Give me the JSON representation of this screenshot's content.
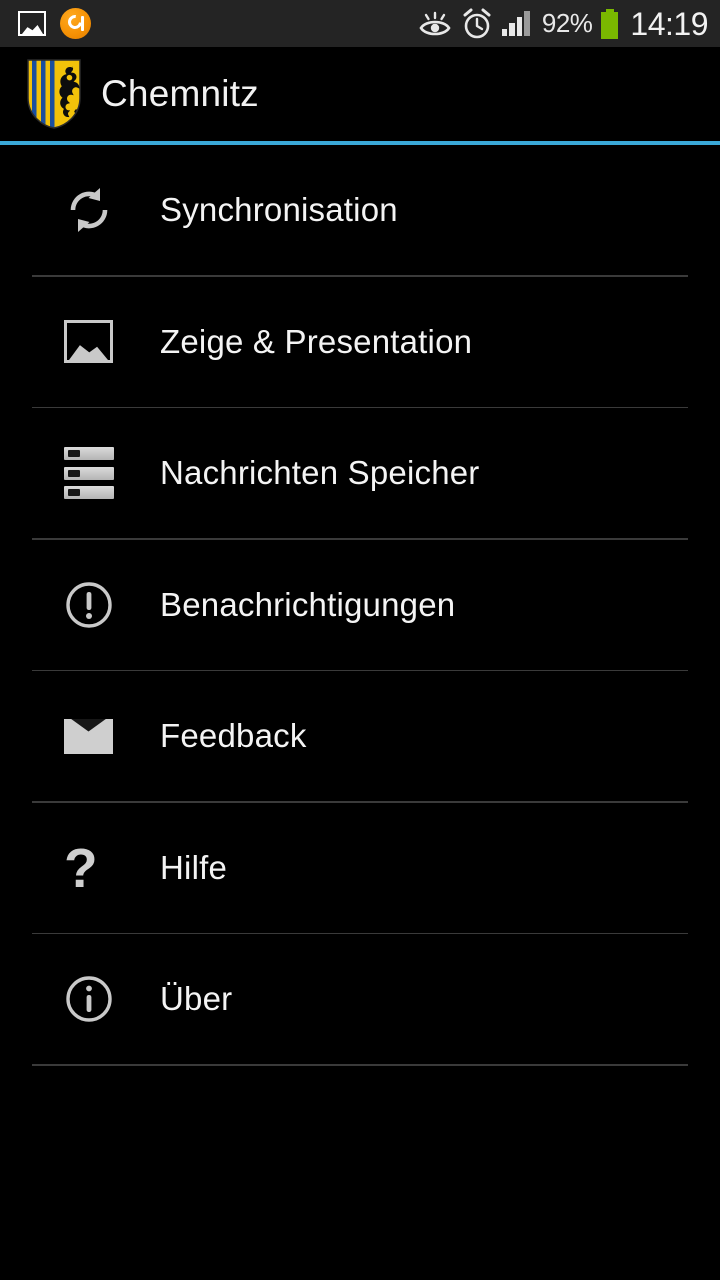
{
  "status_bar": {
    "background": "#242424",
    "left_icons": [
      {
        "name": "screenshot-icon",
        "label": "Screenshot captured"
      },
      {
        "name": "app-notification-icon",
        "label": "App notification",
        "color": "#f59105"
      }
    ],
    "right_icons": [
      {
        "name": "smart-stay-eye-icon",
        "label": "Smart stay"
      },
      {
        "name": "alarm-clock-icon",
        "label": "Alarm set"
      },
      {
        "name": "signal-bars-icon",
        "label": "Mobile signal",
        "bars_filled": 3,
        "bars_total": 4
      }
    ],
    "battery_percent": "92%",
    "battery_color": "#7ab800",
    "clock": "14:19"
  },
  "header": {
    "title": "Chemnitz",
    "crest_name": "chemnitz-coat-of-arms",
    "accent_color": "#3aa8d8",
    "crest_colors": {
      "field": "#f2c20a",
      "stripes": "#1a4fa0",
      "lion": "#0d0d0d"
    }
  },
  "menu": {
    "items": [
      {
        "label": "Synchronisation",
        "icon": "sync-icon"
      },
      {
        "label": "Zeige & Presentation",
        "icon": "image-icon"
      },
      {
        "label": "Nachrichten Speicher",
        "icon": "storage-icon"
      },
      {
        "label": "Benachrichtigungen",
        "icon": "alert-circle-icon"
      },
      {
        "label": "Feedback",
        "icon": "envelope-icon"
      },
      {
        "label": "Hilfe",
        "icon": "question-mark-icon",
        "glyph": "?"
      },
      {
        "label": "Über",
        "icon": "info-circle-icon"
      }
    ]
  },
  "theme": {
    "background": "#000000",
    "text_color": "#f4f4f4",
    "divider_color": "#3a3a3a",
    "icon_color": "#c9c9c9"
  }
}
